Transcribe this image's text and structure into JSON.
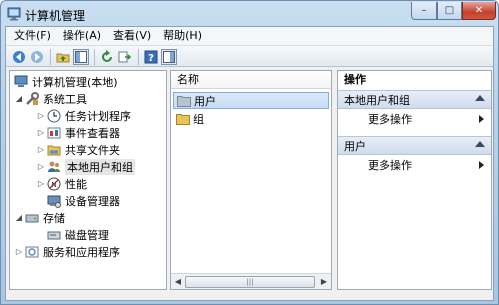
{
  "window": {
    "title": "计算机管理",
    "controls": {
      "minimize": "–",
      "maximize": "□",
      "close": "✕"
    }
  },
  "menu": [
    "文件(F)",
    "操作(A)",
    "查看(V)",
    "帮助(H)"
  ],
  "toolbar": {
    "buttons": [
      "back-icon",
      "forward-icon",
      "up-folder-icon",
      "show-hide-tree-icon",
      "refresh-icon",
      "export-icon",
      "help-icon",
      "show-hide-action-icon"
    ]
  },
  "tree": {
    "root": "计算机管理(本地)",
    "system_tools": "系统工具",
    "task_scheduler": "任务计划程序",
    "event_viewer": "事件查看器",
    "shared_folders": "共享文件夹",
    "local_users_groups": "本地用户和组",
    "performance": "性能",
    "device_manager": "设备管理器",
    "storage": "存储",
    "disk_management": "磁盘管理",
    "services_apps": "服务和应用程序"
  },
  "list": {
    "column_name": "名称",
    "items": [
      "用户",
      "组"
    ],
    "selected_index": 0
  },
  "actions": {
    "header": "操作",
    "sections": [
      {
        "title": "本地用户和组",
        "item": "更多操作"
      },
      {
        "title": "用户",
        "item": "更多操作"
      }
    ]
  },
  "colors": {
    "title_bar": "#b7d0e8",
    "selection": "#c4dbf5",
    "close_button": "#c4412c"
  }
}
